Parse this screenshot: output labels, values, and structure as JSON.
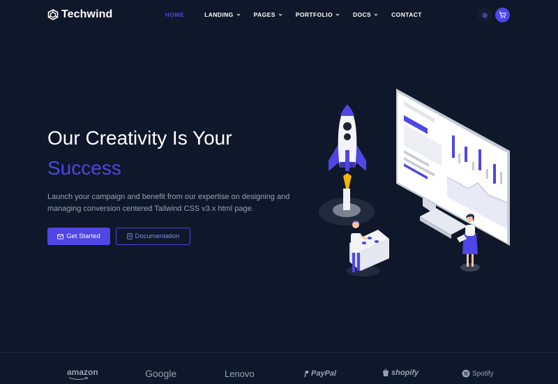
{
  "brand": {
    "name": "Techwind"
  },
  "nav": {
    "items": [
      {
        "label": "HOME"
      },
      {
        "label": "LANDING"
      },
      {
        "label": "PAGES"
      },
      {
        "label": "PORTFOLIO"
      },
      {
        "label": "DOCS"
      },
      {
        "label": "CONTACT"
      }
    ]
  },
  "hero": {
    "title": "Our Creativity Is Your",
    "title_accent": "Success",
    "description": "Launch your campaign and benefit from our expertise on designing and managing conversion centered Tailwind CSS v3.x html page.",
    "primary_button": "Get Started",
    "secondary_button": "Documentation"
  },
  "clients": [
    "amazon",
    "Google",
    "Lenovo",
    "PayPal",
    "shopify",
    "Spotify"
  ],
  "colors": {
    "background": "#0f172a",
    "accent": "#4f46e5",
    "muted_text": "#94a3b8"
  },
  "icons": [
    "logo-icon",
    "chevron-down-icon",
    "settings-icon",
    "cart-icon",
    "mail-icon",
    "book-icon",
    "paypal-icon",
    "shopify-bag-icon",
    "spotify-icon"
  ]
}
